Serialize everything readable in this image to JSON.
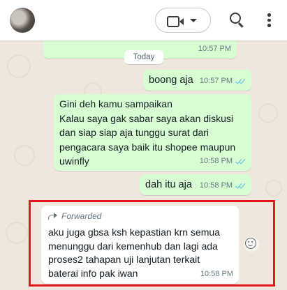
{
  "header": {
    "video_call_icon": "video-camera-icon",
    "call_dropdown_icon": "caret-down-icon",
    "search_icon": "search-icon",
    "menu_icon": "more-vertical-icon"
  },
  "date_separator": "Today",
  "messages": [
    {
      "type": "out",
      "text": "",
      "time": "10:57 PM"
    },
    {
      "type": "out",
      "text": "boong aja",
      "time": "10:57 PM"
    },
    {
      "type": "out",
      "text": "Gini deh kamu sampaikan\nKalau saya gak sabar saya akan diskusi dan siap siap aja tunggu surat dari pengacara saya baik itu shopee maupun uwinfly",
      "time": "10:58 PM"
    },
    {
      "type": "out",
      "text": "dah itu aja",
      "time": "10:58 PM"
    },
    {
      "type": "in",
      "forwarded_label": "Forwarded",
      "text": "aku juga gbsa ksh kepastian krn semua menunggu dari kemenhub dan lagi ada proses2 tahapan uji lanjutan terkait baterai info pak iwan",
      "time": "10:58 PM"
    }
  ],
  "colors": {
    "outgoing_bubble": "#d9fdd3",
    "incoming_bubble": "#ffffff",
    "read_ticks": "#53bdeb",
    "highlight_border": "#e8141c",
    "chat_background": "#efe7dd"
  }
}
